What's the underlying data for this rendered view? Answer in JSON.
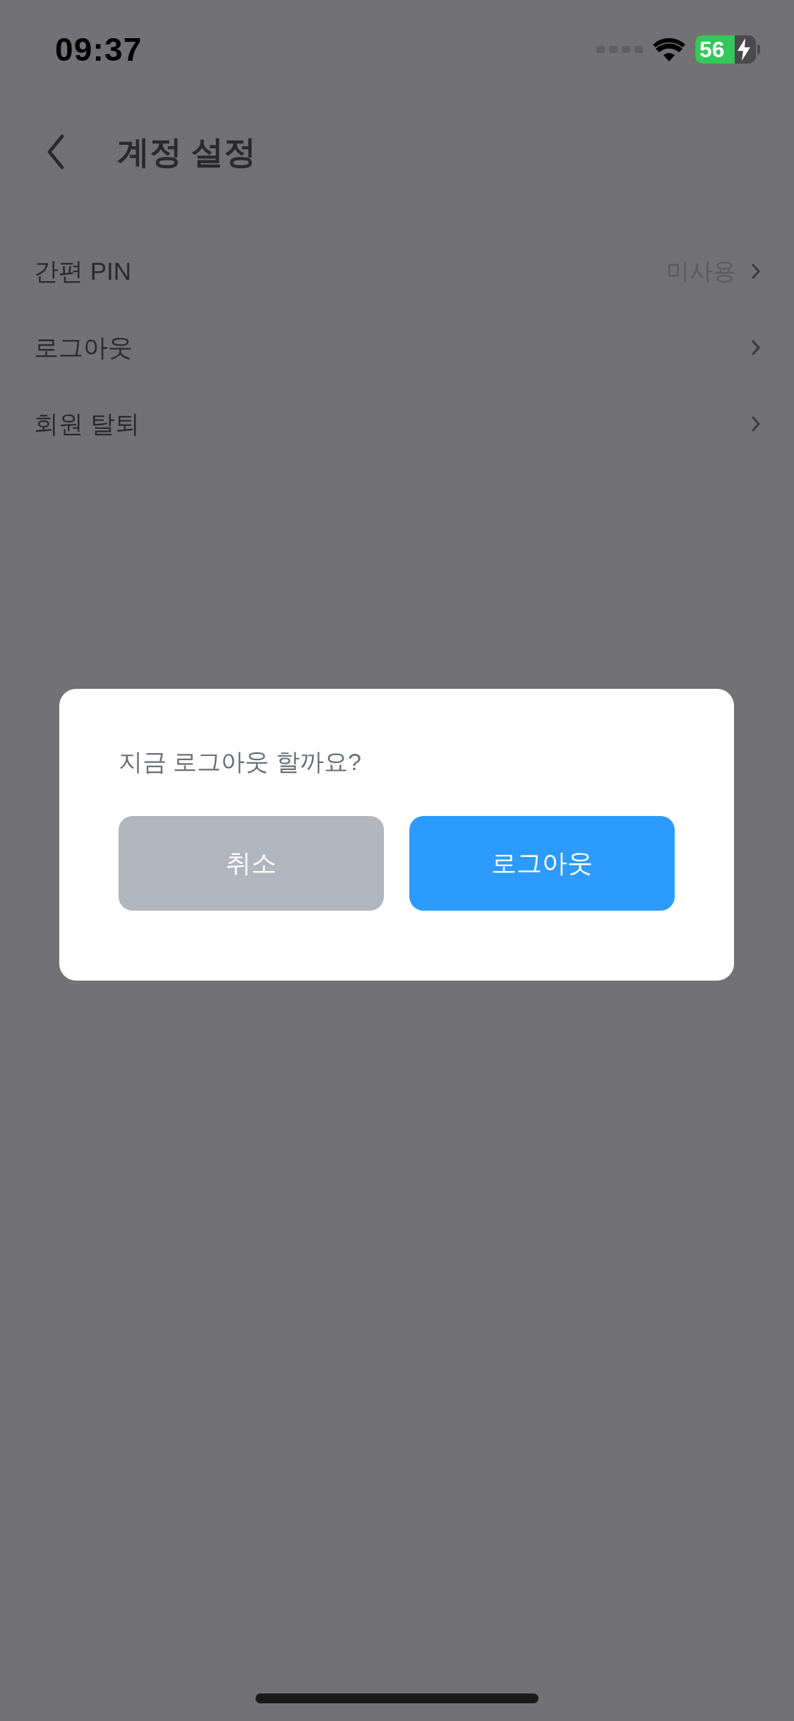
{
  "status_bar": {
    "time": "09:37",
    "battery": "56"
  },
  "header": {
    "title": "계정 설정"
  },
  "settings": [
    {
      "label": "간편 PIN",
      "value": "미사용"
    },
    {
      "label": "로그아웃"
    },
    {
      "label": "회원 탈퇴"
    }
  ],
  "dialog": {
    "message": "지금 로그아웃 할까요?",
    "buttons": [
      {
        "label": "취소",
        "kind": "cancel"
      },
      {
        "label": "로그아웃",
        "kind": "confirm"
      }
    ]
  }
}
